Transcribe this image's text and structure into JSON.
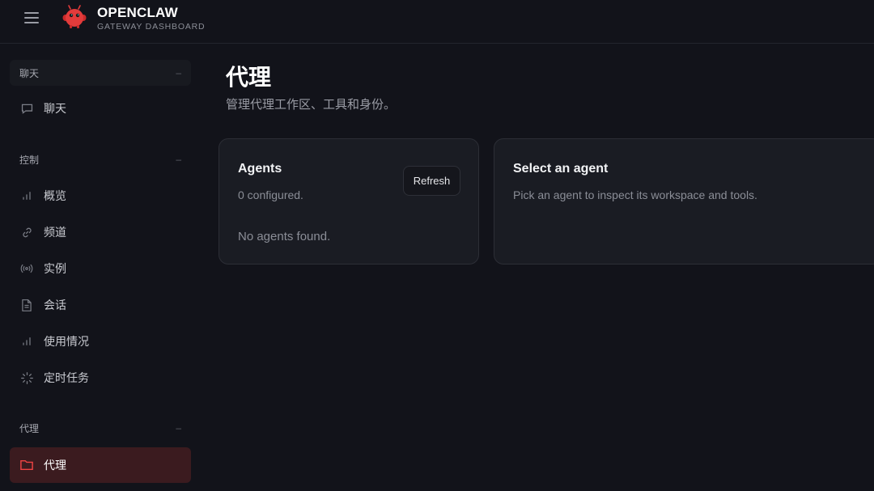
{
  "header": {
    "brand_title": "OPENCLAW",
    "brand_subtitle": "GATEWAY DASHBOARD",
    "logo_icon": "red-crab-mascot",
    "menu_icon": "hamburger-icon"
  },
  "sidebar": {
    "sections": [
      {
        "label": "聊天",
        "collapse_glyph": "–",
        "items": [
          {
            "label": "聊天",
            "icon": "chat-bubble-icon"
          }
        ]
      },
      {
        "label": "控制",
        "collapse_glyph": "–",
        "items": [
          {
            "label": "概览",
            "icon": "bar-chart-icon"
          },
          {
            "label": "频道",
            "icon": "link-icon"
          },
          {
            "label": "实例",
            "icon": "broadcast-icon"
          },
          {
            "label": "会话",
            "icon": "document-icon"
          },
          {
            "label": "使用情况",
            "icon": "bar-chart-icon"
          },
          {
            "label": "定时任务",
            "icon": "loader-icon"
          }
        ]
      },
      {
        "label": "代理",
        "collapse_glyph": "–",
        "items": [
          {
            "label": "代理",
            "icon": "folder-icon",
            "selected": true
          }
        ]
      }
    ]
  },
  "main": {
    "title": "代理",
    "subtitle": "管理代理工作区、工具和身份。",
    "agents_card": {
      "title": "Agents",
      "count_text": "0 configured.",
      "refresh_label": "Refresh",
      "empty_text": "No agents found."
    },
    "select_card": {
      "title": "Select an agent",
      "hint": "Pick an agent to inspect its workspace and tools."
    }
  },
  "colors": {
    "background": "#12131a",
    "card": "#1a1c23",
    "accent": "#ef4444",
    "selected_bg": "#3b1b1f"
  }
}
